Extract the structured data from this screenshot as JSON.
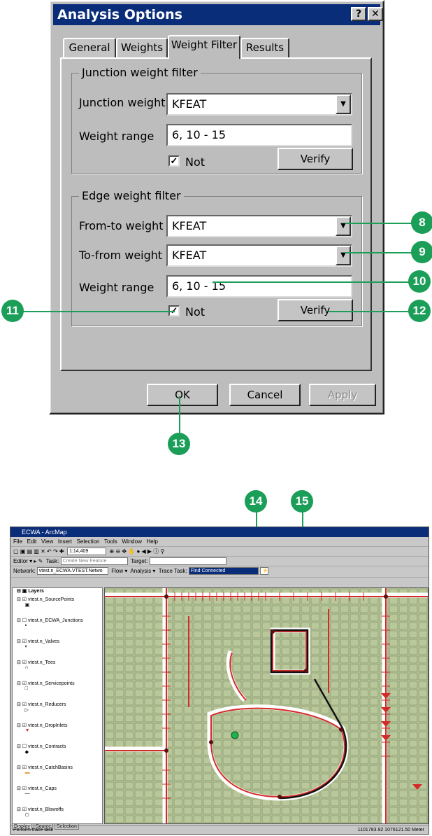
{
  "dialog": {
    "title": "Analysis Options",
    "help_button": "?",
    "close_button": "✕",
    "tabs": [
      "General",
      "Weights",
      "Weight Filter",
      "Results"
    ],
    "active_tab": "Weight Filter",
    "junction_group": {
      "title": "Junction weight filter",
      "weight_label": "Junction weight",
      "weight_value": "KFEAT",
      "range_label": "Weight range",
      "range_value": "6, 10 - 15",
      "not_label": "Not",
      "not_checked": true,
      "verify_label": "Verify"
    },
    "edge_group": {
      "title": "Edge weight filter",
      "from_to_label": "From-to weight",
      "from_to_value": "KFEAT",
      "to_from_label": "To-from weight",
      "to_from_value": "KFEAT",
      "range_label": "Weight range",
      "range_value": "6, 10 - 15",
      "not_label": "Not",
      "not_checked": true,
      "verify_label": "Verify"
    },
    "buttons": {
      "ok": "OK",
      "cancel": "Cancel",
      "apply": "Apply"
    }
  },
  "callouts": {
    "c8": "8",
    "c9": "9",
    "c10": "10",
    "c11": "11",
    "c12": "12",
    "c13": "13",
    "c14": "14",
    "c15": "15"
  },
  "arcmap": {
    "title": "ECWA - ArcMap",
    "menu": [
      "File",
      "Edit",
      "View",
      "Insert",
      "Selection",
      "Tools",
      "Window",
      "Help"
    ],
    "scale": "1:14,409",
    "editor_label": "Editor ▾",
    "task_label": "Task:",
    "task_value": "Create New Feature",
    "target_label": "Target:",
    "network_label": "Network:",
    "network_value": "vtest.n_ECWA.VTEST.Netwo",
    "flow_label": "Flow ▾",
    "analysis_label": "Analysis ▾",
    "trace_task_label": "Trace Task:",
    "trace_task_value": "Find Connected",
    "toc_root": "Layers",
    "layers": [
      {
        "name": "vtest.n_SourcePoints",
        "checked": true
      },
      {
        "name": "vtest.n_ECWA_Junctions",
        "checked": false
      },
      {
        "name": "vtest.n_Valves",
        "checked": true
      },
      {
        "name": "vtest.n_Tees",
        "checked": true
      },
      {
        "name": "vtest.n_Servicepoints",
        "checked": true
      },
      {
        "name": "vtest.n_Reducers",
        "checked": true
      },
      {
        "name": "vtest.n_DropInlets",
        "checked": true
      },
      {
        "name": "vtest.n_Contracts",
        "checked": false
      },
      {
        "name": "vtest.n_CatchBasins",
        "checked": true
      },
      {
        "name": "vtest.n_Caps",
        "checked": true
      },
      {
        "name": "vtest.n_Blowoffs",
        "checked": true
      }
    ],
    "toc_tabs": [
      "Display",
      "Source",
      "Selection"
    ],
    "status_left": "Perform trace task",
    "status_right": "1101783.92  1076121.50 Meter",
    "colors": {
      "map_bg": "#b9c89a",
      "mains": "#d42a2a",
      "title_bar": "#0a2d7a"
    }
  }
}
